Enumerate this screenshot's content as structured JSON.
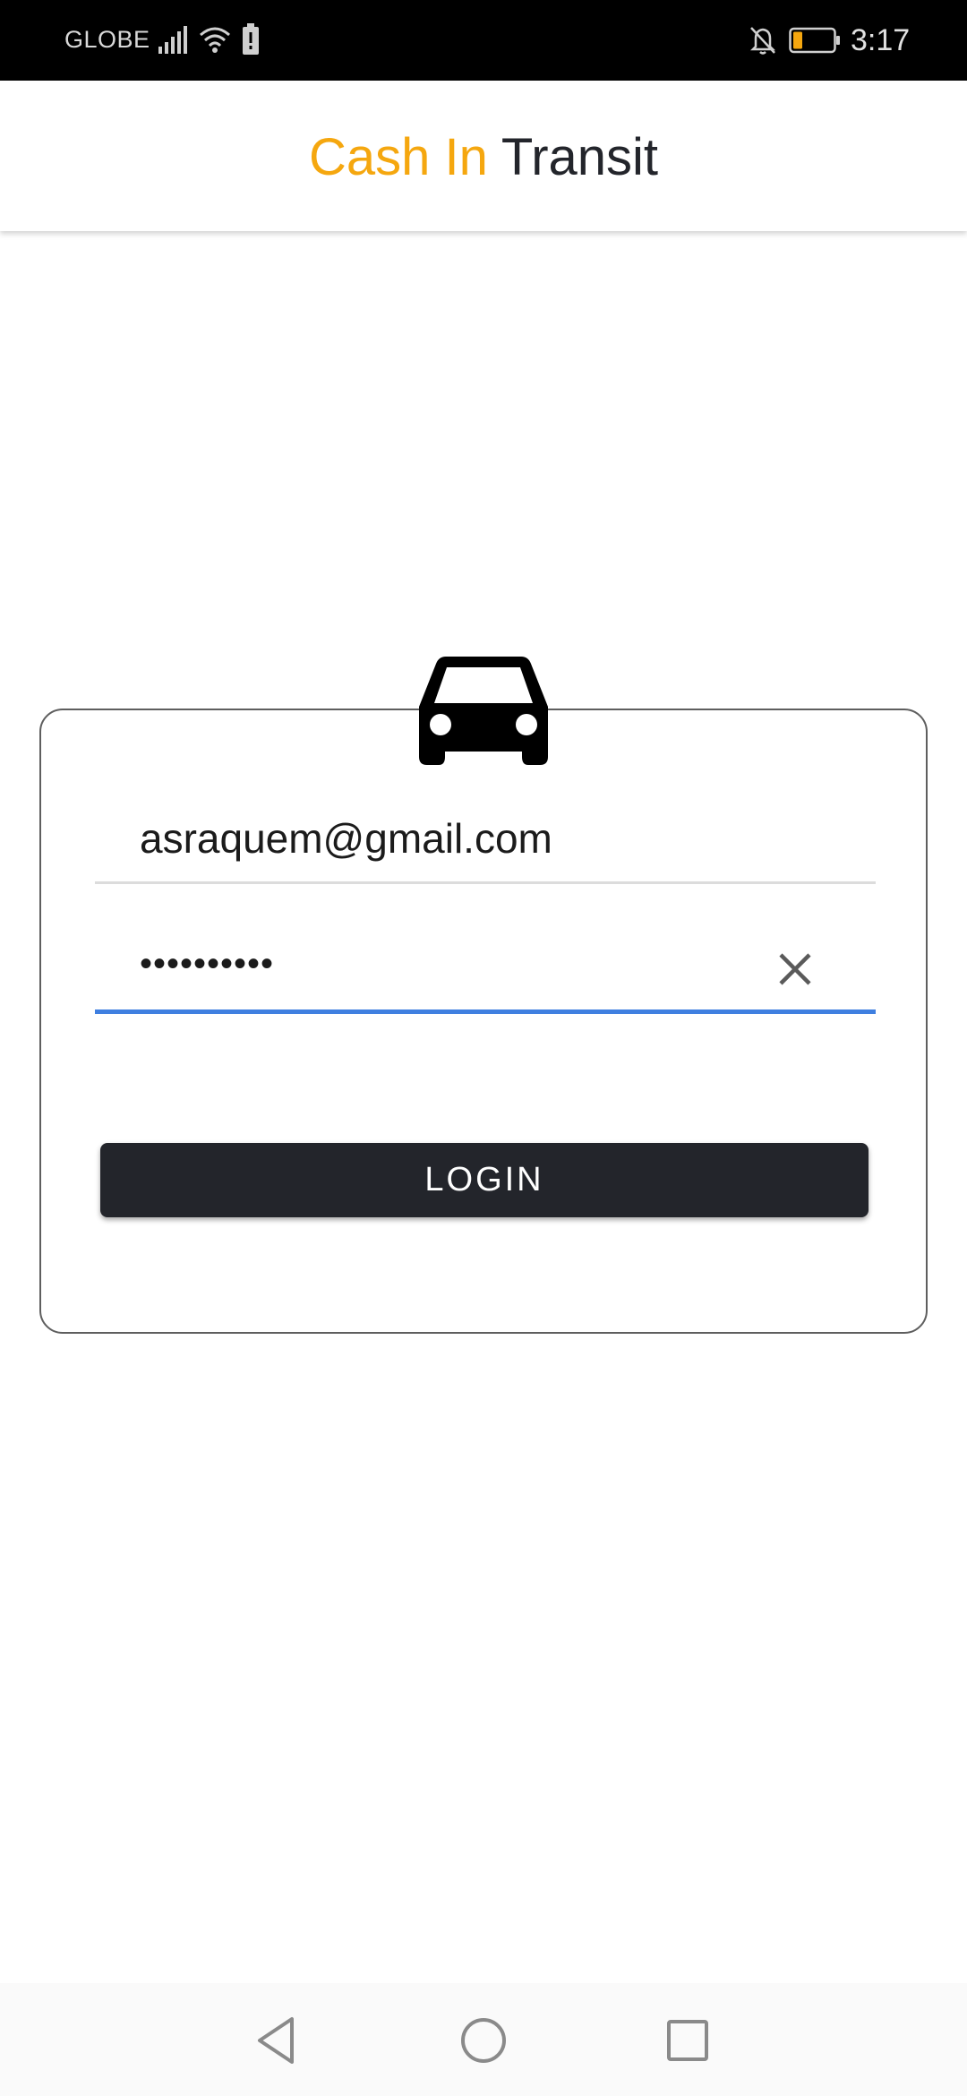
{
  "status_bar": {
    "carrier": "GLOBE",
    "time": "3:17",
    "icons": [
      "signal-icon",
      "wifi-icon",
      "battery-alert-icon",
      "bell-off-icon",
      "battery-icon"
    ]
  },
  "app_bar": {
    "title_accent": "Cash In",
    "title_main": "Transit"
  },
  "login": {
    "icon": "car-icon",
    "email_value": "asraquem@gmail.com",
    "password_masked": "••••••••••",
    "clear_icon": "close-icon",
    "button_label": "LOGIN"
  },
  "nav_bar": {
    "icons": [
      "back-icon",
      "home-icon",
      "recents-icon"
    ]
  },
  "colors": {
    "accent": "#f5a70f",
    "dark": "#23252b",
    "focus_underline": "#3f7fe0",
    "battery_low": "#f5a70f"
  }
}
